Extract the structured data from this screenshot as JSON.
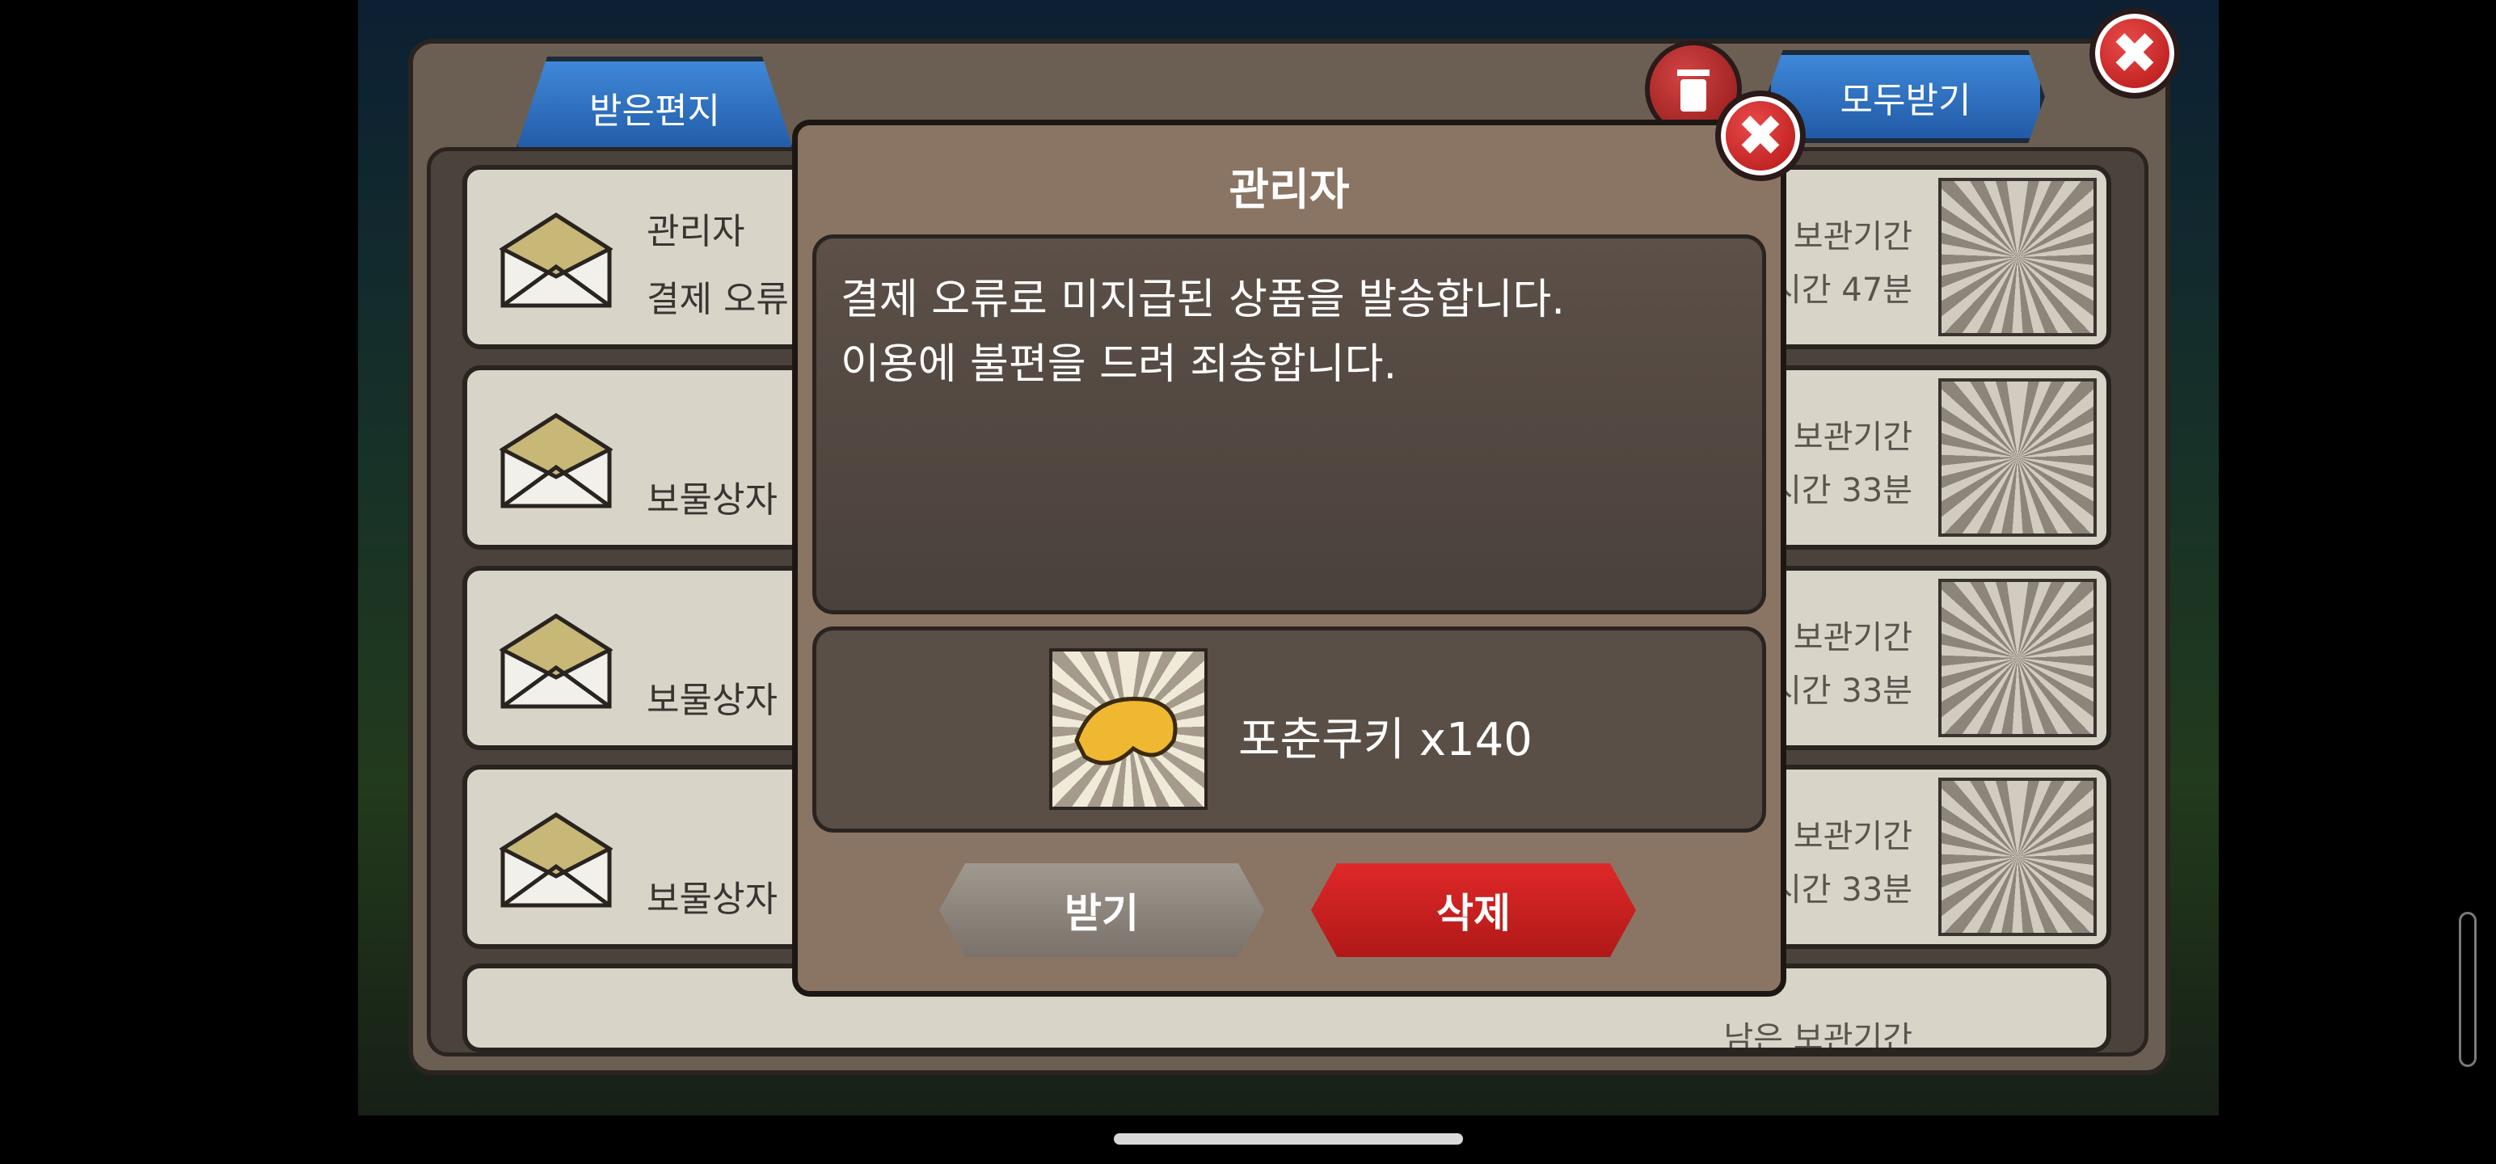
{
  "mailbox": {
    "tab_label": "받은편지",
    "claim_all_label": "모두받기",
    "rows": [
      {
        "sender": "관리자",
        "subject": "결제 오류",
        "expire_label": "보관기간",
        "expire_time": "시간 47분"
      },
      {
        "sender": "",
        "subject": "보물상자",
        "expire_label": "보관기간",
        "expire_time": "시간 33분"
      },
      {
        "sender": "",
        "subject": "보물상자",
        "expire_label": "보관기간",
        "expire_time": "시간 33분"
      },
      {
        "sender": "",
        "subject": "보물상자",
        "expire_label": "보관기간",
        "expire_time": "시간 33분"
      },
      {
        "sender": "",
        "subject": "",
        "expire_label": "남은 보관기간",
        "expire_time": ""
      }
    ]
  },
  "dialog": {
    "title": "관리자",
    "message_line1": "결제 오류로 미지급된 상품을 발송합니다.",
    "message_line2": "이용에 불편을 드려 죄송합니다.",
    "reward_label": "포춘쿠키 x140",
    "reward_icon": "fortune-cookie-icon",
    "receive_label": "받기",
    "delete_label": "삭제"
  },
  "colors": {
    "tab_blue": "#2f70c0",
    "delete_red": "#c81e1e",
    "panel_brown": "#8a7565"
  }
}
